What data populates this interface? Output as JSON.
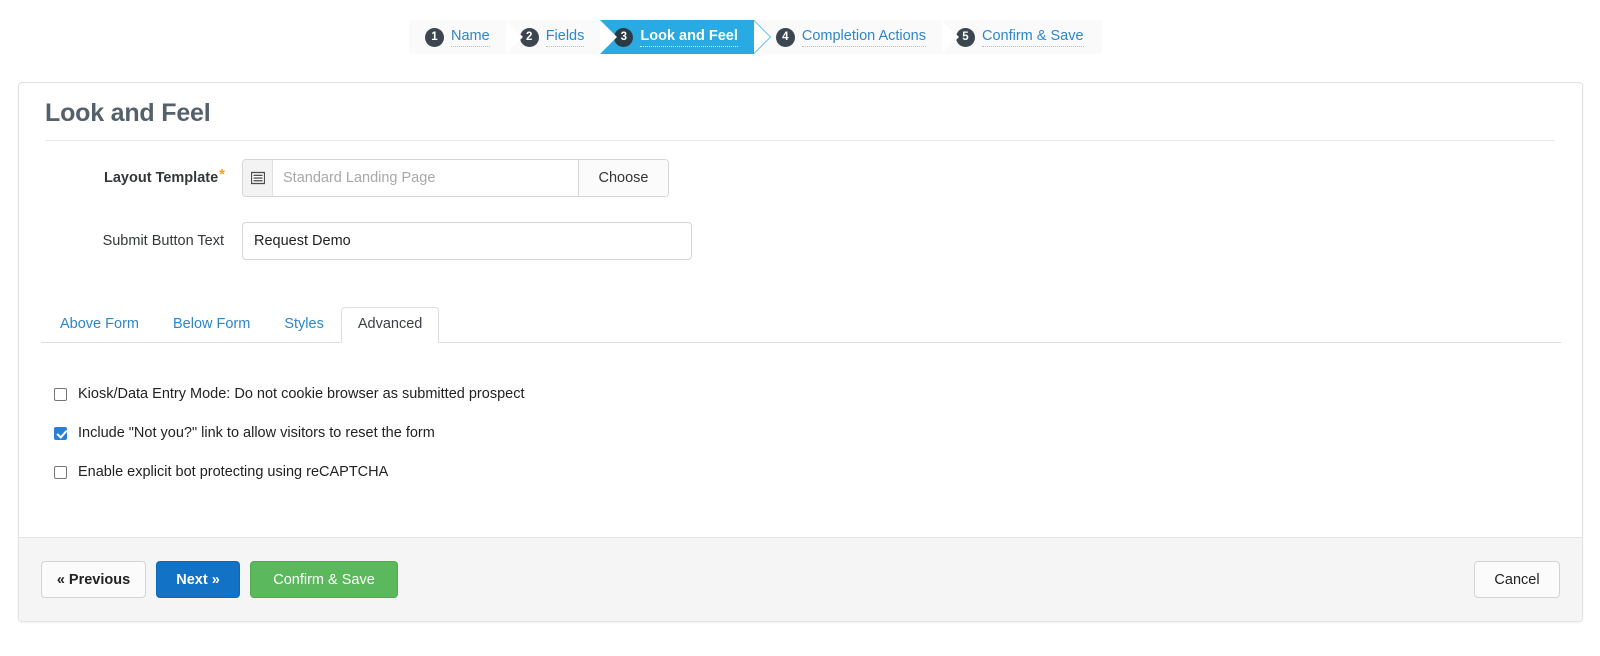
{
  "wizard": {
    "steps": [
      {
        "num": "1",
        "label": "Name",
        "active": false
      },
      {
        "num": "2",
        "label": "Fields",
        "active": false
      },
      {
        "num": "3",
        "label": "Look and Feel",
        "active": true
      },
      {
        "num": "4",
        "label": "Completion Actions",
        "active": false
      },
      {
        "num": "5",
        "label": "Confirm & Save",
        "active": false
      }
    ]
  },
  "panel": {
    "title": "Look and Feel"
  },
  "form": {
    "layout_template": {
      "label": "Layout Template",
      "required_marker": "*",
      "icon": "layout-template-icon",
      "value": "",
      "placeholder": "Standard Landing Page",
      "choose_label": "Choose"
    },
    "submit_button_text": {
      "label": "Submit Button Text",
      "value": "Request Demo",
      "placeholder": ""
    }
  },
  "tabs": [
    {
      "label": "Above Form",
      "active": false
    },
    {
      "label": "Below Form",
      "active": false
    },
    {
      "label": "Styles",
      "active": false
    },
    {
      "label": "Advanced",
      "active": true
    }
  ],
  "advanced_options": [
    {
      "label": "Kiosk/Data Entry Mode: Do not cookie browser as submitted prospect",
      "checked": false
    },
    {
      "label": "Include \"Not you?\" link to allow visitors to reset the form",
      "checked": true
    },
    {
      "label": "Enable explicit bot protecting using reCAPTCHA",
      "checked": false
    }
  ],
  "footer": {
    "previous_label": "« Previous",
    "next_label": "Next »",
    "confirm_save_label": "Confirm & Save",
    "cancel_label": "Cancel"
  },
  "colors": {
    "active_step": "#29aae2",
    "link": "#2e86c8",
    "primary_button": "#1272c5",
    "success_button": "#5cb85c",
    "required_marker": "#f0a030",
    "highlight_border": "#1f3342",
    "checkbox_checked": "#2a7fd4"
  }
}
